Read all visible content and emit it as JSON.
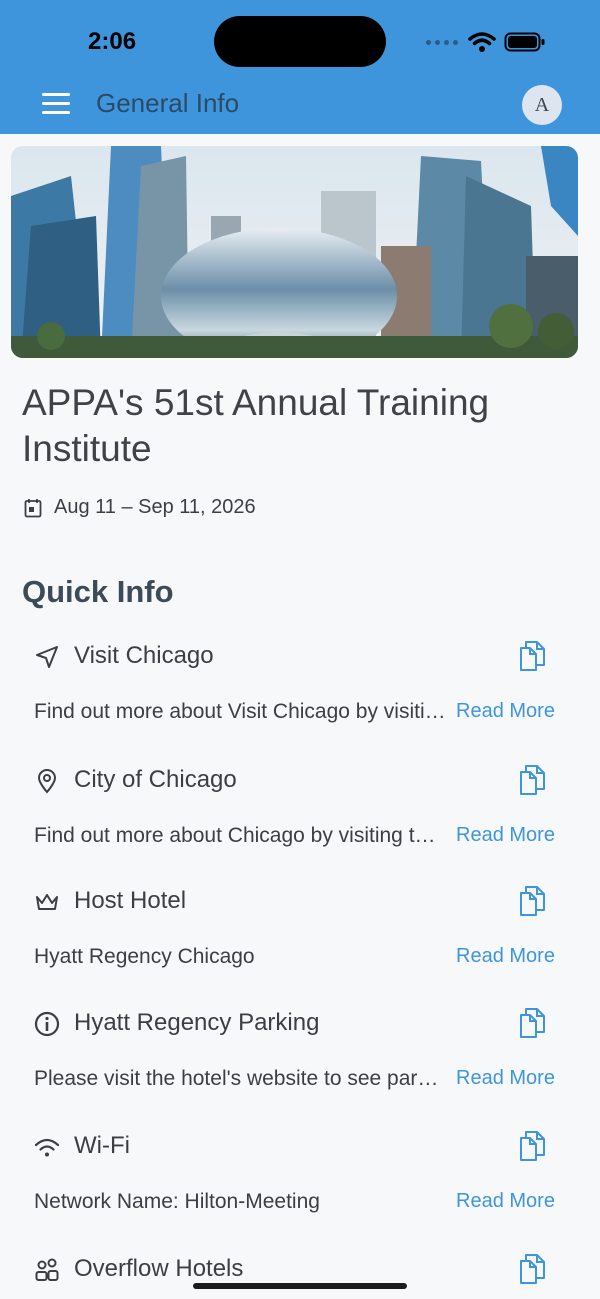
{
  "status_bar": {
    "time": "2:06"
  },
  "header": {
    "title": "General Info",
    "avatar_letter": "A"
  },
  "event": {
    "title": "APPA's 51st Annual Training Institute",
    "date": "Aug 11 – Sep 11, 2026"
  },
  "quick_info": {
    "heading": "Quick Info",
    "read_more_label": "Read More",
    "items": [
      {
        "title": "Visit Chicago",
        "desc": "Find out more about Visit Chicago by visiting their website",
        "icon": "navigation-arrow-icon"
      },
      {
        "title": "City of Chicago",
        "desc": "Find out more about Chicago by visiting the city website",
        "icon": "map-pin-icon"
      },
      {
        "title": "Host Hotel",
        "desc": "Hyatt Regency Chicago",
        "icon": "crown-icon"
      },
      {
        "title": "Hyatt Regency Parking",
        "desc": "Please visit the hotel's website to see parking details",
        "icon": "info-icon"
      },
      {
        "title": "Wi-Fi",
        "desc": "Network Name: Hilton-Meeting",
        "icon": "wifi-icon"
      },
      {
        "title": "Overflow Hotels",
        "desc": "",
        "icon": "group-icon"
      }
    ]
  },
  "colors": {
    "header": "#3f95db",
    "link": "#3f95db",
    "background": "#f7f8f9"
  }
}
